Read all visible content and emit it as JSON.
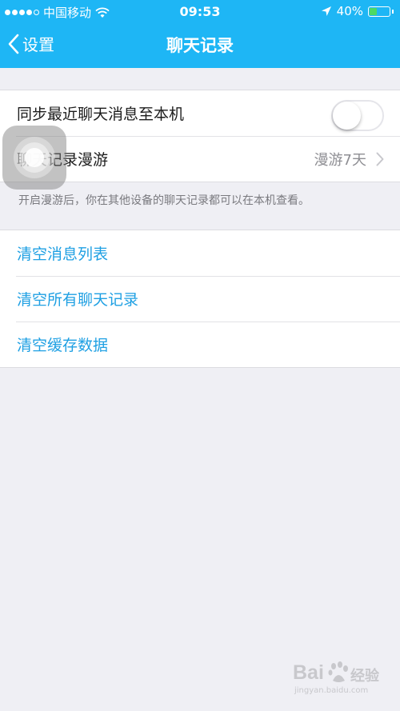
{
  "status_bar": {
    "carrier": "中国移动",
    "time": "09:53",
    "battery_percent": "40%",
    "battery_level": 0.4,
    "signal_bars": 4,
    "signal_total": 5
  },
  "nav": {
    "back_label": "设置",
    "title": "聊天记录"
  },
  "sync_group": {
    "sync_label": "同步最近聊天消息至本机",
    "sync_enabled": false,
    "roaming_label": "聊天记录漫游",
    "roaming_value": "漫游7天",
    "note": "开启漫游后，你在其他设备的聊天记录都可以在本机查看。"
  },
  "clear_group": {
    "items": [
      "清空消息列表",
      "清空所有聊天记录",
      "清空缓存数据"
    ]
  },
  "watermark": {
    "brand": "Bai",
    "brand_cn": "经验",
    "url": "jingyan.baidu.com"
  },
  "colors": {
    "header": "#1eb6f5",
    "link": "#1fa0e3",
    "background": "#efeff4"
  }
}
